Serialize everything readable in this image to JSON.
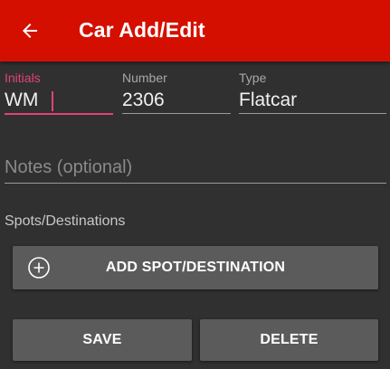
{
  "appbar": {
    "title": "Car Add/Edit",
    "back_icon": "arrow-left-icon",
    "background_color": "#d50f00"
  },
  "form": {
    "initials": {
      "label": "Initials",
      "value": "WM",
      "focused": true
    },
    "number": {
      "label": "Number",
      "value": "2306"
    },
    "type": {
      "label": "Type",
      "value": "Flatcar"
    },
    "notes": {
      "placeholder": "Notes (optional)",
      "value": ""
    }
  },
  "spots": {
    "section_label": "Spots/Destinations",
    "add_button_label": "ADD SPOT/DESTINATION",
    "add_icon": "add-circle-icon"
  },
  "actions": {
    "save_label": "SAVE",
    "delete_label": "DELETE"
  },
  "colors": {
    "accent": "#e0427c",
    "background": "#303030",
    "button": "#5b5b5b"
  }
}
